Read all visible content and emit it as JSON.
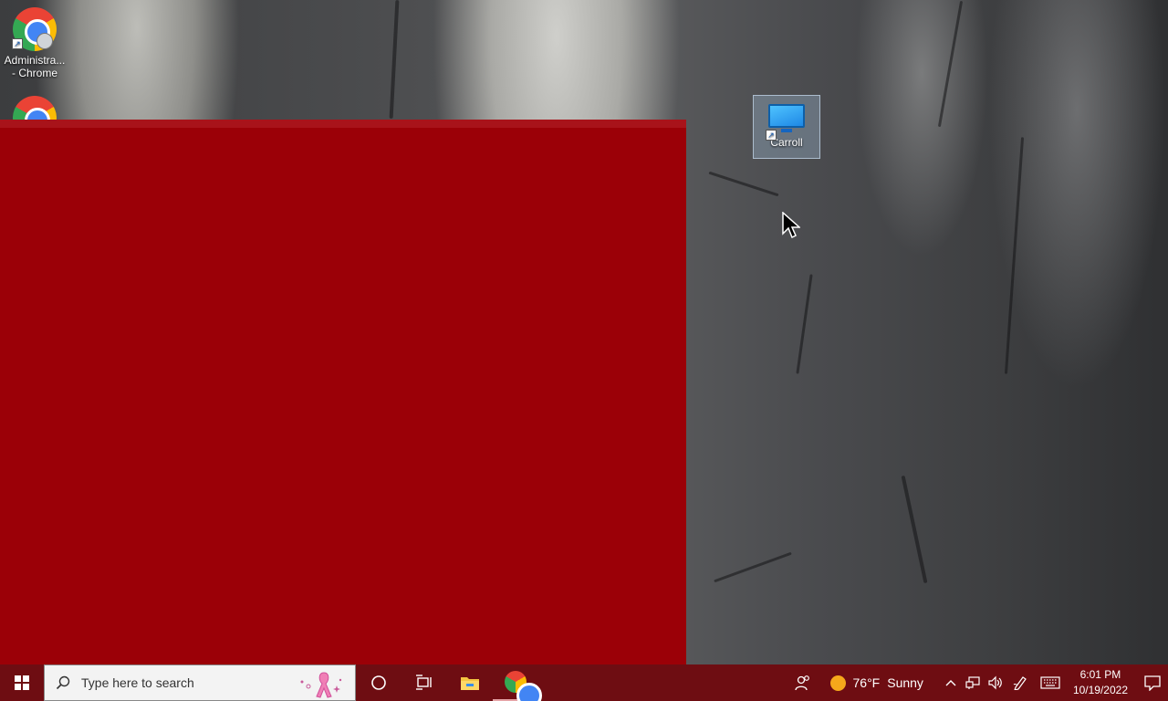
{
  "desktop": {
    "icons": [
      {
        "label": "Administra... - Chrome",
        "label_line1": "Administra...",
        "label_line2": "- Chrome",
        "icon": "chrome-icon"
      },
      {
        "label": "",
        "icon": "chrome-icon"
      },
      {
        "label": "Carroll",
        "icon": "monitor-icon",
        "selected": true
      }
    ]
  },
  "taskbar": {
    "search": {
      "placeholder": "Type here to search",
      "decoration": "pink-ribbon-icon"
    },
    "pinned": [
      "cortana-icon",
      "task-view-icon",
      "file-explorer-icon",
      "chrome-icon"
    ],
    "weather": {
      "temperature": "76°F",
      "condition": "Sunny",
      "icon": "sun-icon"
    },
    "tray_icons": [
      "people-icon",
      "chevron-up-icon",
      "network-icon",
      "volume-icon",
      "pen-icon",
      "keyboard-icon"
    ],
    "clock": {
      "time": "6:01 PM",
      "date": "10/19/2022"
    },
    "notification_icon": "notification-icon"
  },
  "colors": {
    "window_red": "#9b0007",
    "taskbar": "#6e0d12",
    "search_bg": "#f3f3f3"
  }
}
